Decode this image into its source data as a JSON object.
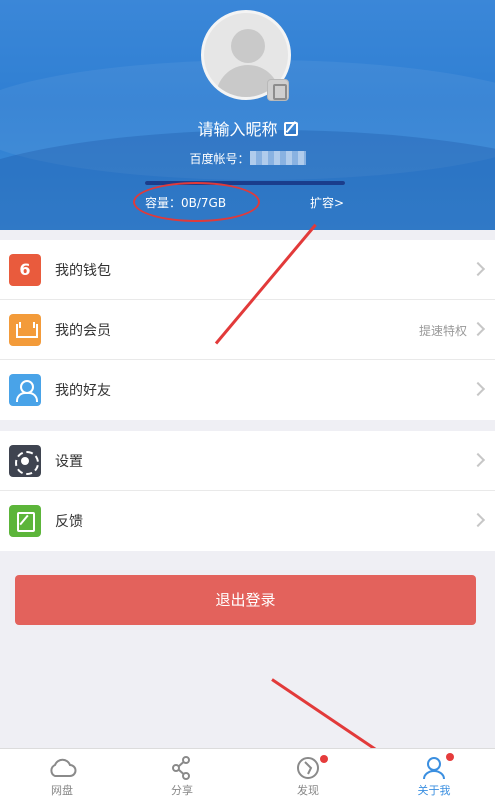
{
  "profile": {
    "nickname": "请输入昵称",
    "account_label": "百度帐号：",
    "capacity_text": "容量：0B/7GB",
    "capacity_used_fraction": 1.0,
    "expand_label": "扩容>"
  },
  "menu_group_1": [
    {
      "label": "我的钱包",
      "icon": "wallet-icon",
      "extra": ""
    },
    {
      "label": "我的会员",
      "icon": "vip-crown-icon",
      "extra": "提速特权"
    },
    {
      "label": "我的好友",
      "icon": "friend-icon",
      "extra": ""
    }
  ],
  "menu_group_2": [
    {
      "label": "设置",
      "icon": "settings-icon"
    },
    {
      "label": "反馈",
      "icon": "feedback-icon"
    }
  ],
  "logout_label": "退出登录",
  "tabbar": [
    {
      "label": "网盘",
      "icon": "cloud-icon",
      "active": false,
      "badge": false
    },
    {
      "label": "分享",
      "icon": "share-icon",
      "active": false,
      "badge": false
    },
    {
      "label": "发现",
      "icon": "discover-icon",
      "active": false,
      "badge": true
    },
    {
      "label": "关于我",
      "icon": "user-icon",
      "active": true,
      "badge": true
    }
  ],
  "colors": {
    "header_blue": "#2f7fd3",
    "logout_red": "#e3625c",
    "annotation_red": "#e03a3a",
    "active_tab": "#3b8fe0"
  }
}
